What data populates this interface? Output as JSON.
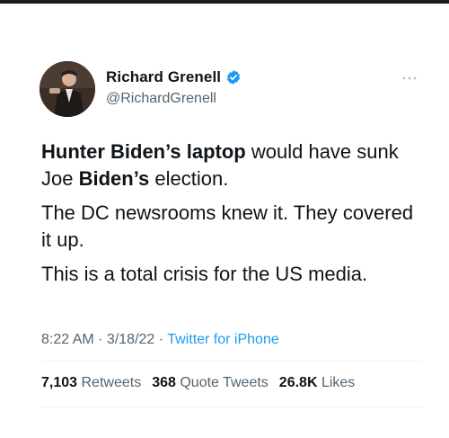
{
  "tweet": {
    "author": {
      "display_name": "Richard Grenell",
      "handle": "@RichardGrenell",
      "verified": true,
      "avatar_icon": "profile-photo"
    },
    "body": {
      "p1": {
        "s1": "Hunter Biden’s laptop",
        "s2": " would have sunk Joe ",
        "s3": "Biden’s",
        "s4": " election."
      },
      "p2": "The DC newsrooms knew it. They covered it up.",
      "p3": "This is a total crisis for the US media."
    },
    "meta": {
      "time": "8:22 AM",
      "sep1": " · ",
      "date": "3/18/22",
      "sep2": " · ",
      "source": "Twitter for iPhone"
    },
    "stats": {
      "retweets_count": "7,103",
      "retweets_label": "Retweets",
      "quotes_count": "368",
      "quotes_label": "Quote Tweets",
      "likes_count": "26.8K",
      "likes_label": "Likes"
    }
  },
  "colors": {
    "verified_badge": "#1d9bf0",
    "link": "#1d9bf0",
    "secondary_text": "#536471",
    "primary_text": "#0f1419"
  }
}
